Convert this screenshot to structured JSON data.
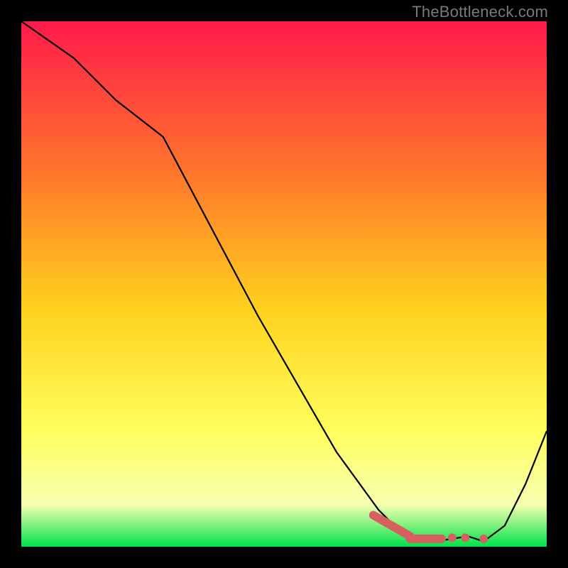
{
  "watermark": "TheBottleneck.com",
  "colors": {
    "background": "#000000",
    "curve": "#000000",
    "marker": "#d66060",
    "gradient_top": "#ff1a4b",
    "gradient_mid1": "#ff7a2a",
    "gradient_mid2": "#ffd21e",
    "gradient_mid3": "#ffff5e",
    "gradient_low": "#f7ffb0",
    "gradient_bottom": "#00e24a"
  },
  "chart_data": {
    "type": "line",
    "title": "",
    "xlabel": "",
    "ylabel": "",
    "xlim": [
      0,
      100
    ],
    "ylim": [
      0,
      100
    ],
    "series": [
      {
        "name": "bottleneck-curve",
        "x": [
          0,
          10,
          18,
          27,
          45,
          60,
          68,
          72,
          76,
          80,
          82,
          85,
          88,
          92,
          96,
          100
        ],
        "y": [
          100,
          93,
          85,
          78,
          44,
          18,
          7,
          3,
          1.5,
          1.2,
          1.5,
          2,
          1,
          4,
          12,
          22
        ]
      }
    ],
    "markers": [
      {
        "name": "marker-segment-1",
        "shape": "segment",
        "x": [
          67,
          74
        ],
        "y": [
          6,
          2
        ]
      },
      {
        "name": "marker-segment-2",
        "shape": "segment",
        "x": [
          74,
          80
        ],
        "y": [
          1.5,
          1.5
        ]
      },
      {
        "name": "marker-dot-1",
        "shape": "dot",
        "x": 82,
        "y": 1.7
      },
      {
        "name": "marker-dot-2",
        "shape": "dot",
        "x": 84.5,
        "y": 1.7
      },
      {
        "name": "marker-dot-3",
        "shape": "dot",
        "x": 88,
        "y": 1.5
      }
    ]
  }
}
